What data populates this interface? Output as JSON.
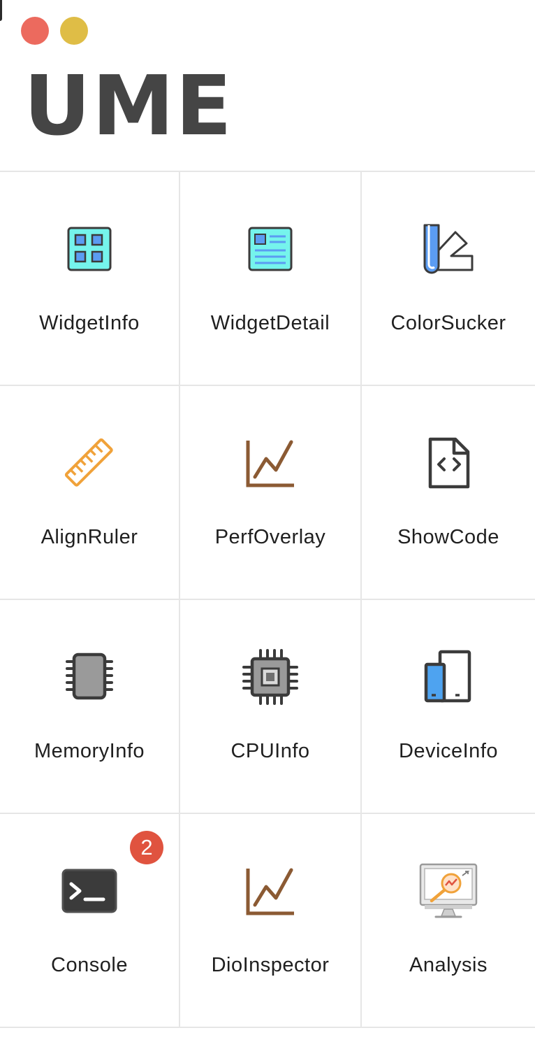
{
  "window": {
    "controls": [
      {
        "name": "close",
        "color": "#ec6a5e"
      },
      {
        "name": "minimize",
        "color": "#dfbd46"
      }
    ]
  },
  "app": {
    "title": "UME"
  },
  "plugins": [
    {
      "label": "WidgetInfo",
      "icon": "widget-grid-icon"
    },
    {
      "label": "WidgetDetail",
      "icon": "widget-detail-icon"
    },
    {
      "label": "ColorSucker",
      "icon": "color-swatch-icon"
    },
    {
      "label": "AlignRuler",
      "icon": "ruler-icon"
    },
    {
      "label": "PerfOverlay",
      "icon": "line-chart-icon"
    },
    {
      "label": "ShowCode",
      "icon": "code-file-icon"
    },
    {
      "label": "MemoryInfo",
      "icon": "memory-chip-icon"
    },
    {
      "label": "CPUInfo",
      "icon": "cpu-icon"
    },
    {
      "label": "DeviceInfo",
      "icon": "devices-icon"
    },
    {
      "label": "Console",
      "icon": "terminal-icon",
      "badge": "2",
      "badge_color": "#e0533f"
    },
    {
      "label": "DioInspector",
      "icon": "line-chart-icon"
    },
    {
      "label": "Analysis",
      "icon": "analysis-monitor-icon"
    }
  ],
  "colors": {
    "accent_cyan": "#75f4ec",
    "accent_blue": "#5b9cf2",
    "ruler_orange": "#f0a23a",
    "chart_brown": "#8b5a33",
    "icon_dark": "#3b3b3b",
    "divider": "#e6e6e6"
  }
}
